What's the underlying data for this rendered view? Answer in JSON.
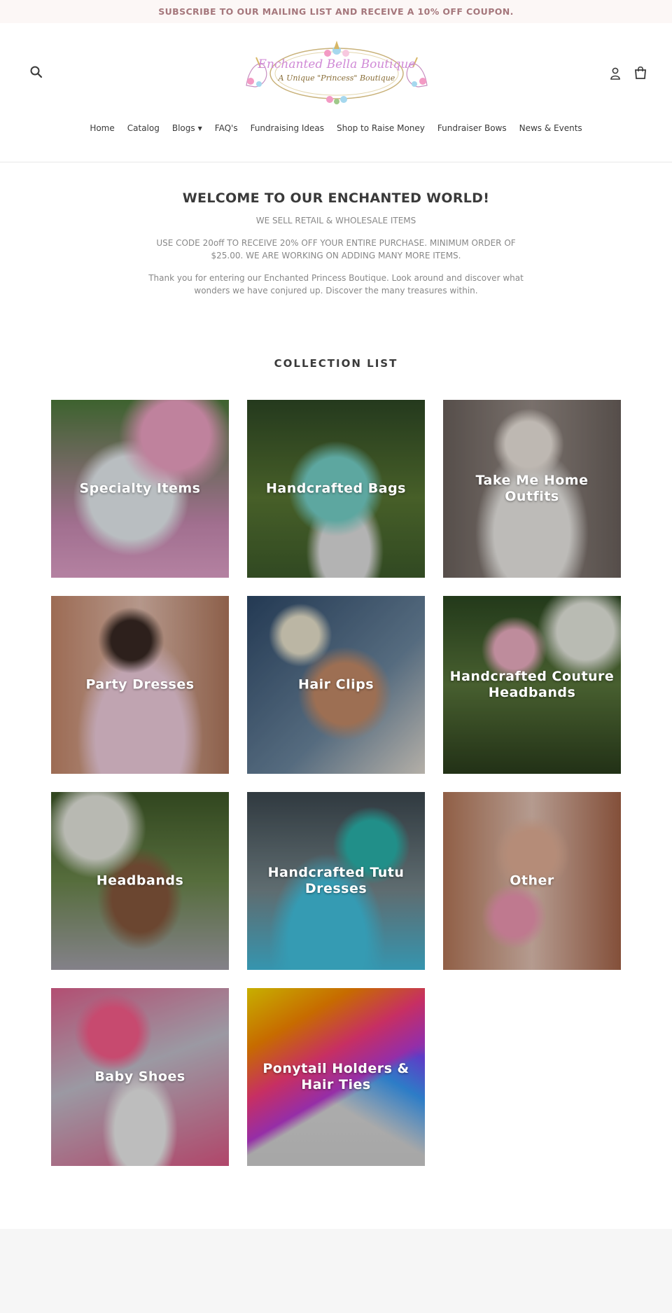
{
  "announcement": {
    "text": "SUBSCRIBE TO OUR MAILING LIST AND RECEIVE A 10% OFF COUPON."
  },
  "header": {
    "icons": {
      "search": "search-icon",
      "account": "account-icon",
      "cart": "cart-icon"
    },
    "logo": {
      "line1": "Enchanted Bella Boutique",
      "line2": "A Unique \"Princess\" Boutique"
    }
  },
  "nav": [
    {
      "label": "Home"
    },
    {
      "label": "Catalog"
    },
    {
      "label": "Blogs",
      "has_dropdown": true
    },
    {
      "label": "FAQ's"
    },
    {
      "label": "Fundraising Ideas"
    },
    {
      "label": "Shop to Raise Money"
    },
    {
      "label": "Fundraiser Bows"
    },
    {
      "label": "News & Events"
    }
  ],
  "welcome": {
    "title": "WELCOME TO OUR ENCHANTED WORLD!",
    "line1": "WE SELL RETAIL & WHOLESALE ITEMS",
    "line2": "USE CODE 20off TO RECEIVE 20% OFF YOUR ENTIRE PURCHASE.  MINIMUM ORDER OF $25.00.  WE ARE WORKING ON ADDING MANY MORE ITEMS.",
    "line3": "Thank you for entering our Enchanted Princess Boutique.  Look around and discover what wonders we have conjured up.  Discover the many treasures within."
  },
  "collection": {
    "title": "COLLECTION LIST",
    "items": [
      {
        "label": "Specialty Items"
      },
      {
        "label": "Handcrafted Bags"
      },
      {
        "label": "Take Me Home Outfits"
      },
      {
        "label": "Party Dresses"
      },
      {
        "label": "Hair Clips"
      },
      {
        "label": "Handcrafted Couture Headbands"
      },
      {
        "label": "Headbands"
      },
      {
        "label": "Handcrafted Tutu Dresses"
      },
      {
        "label": "Other"
      },
      {
        "label": "Baby Shoes"
      },
      {
        "label": "Ponytail Holders & Hair Ties"
      }
    ]
  },
  "colors": {
    "announcement_text": "#a5777c",
    "announcement_bg": "#fcf7f6",
    "text": "#3a3a3a",
    "muted": "#888888",
    "footer_bg": "#f6f6f6"
  }
}
